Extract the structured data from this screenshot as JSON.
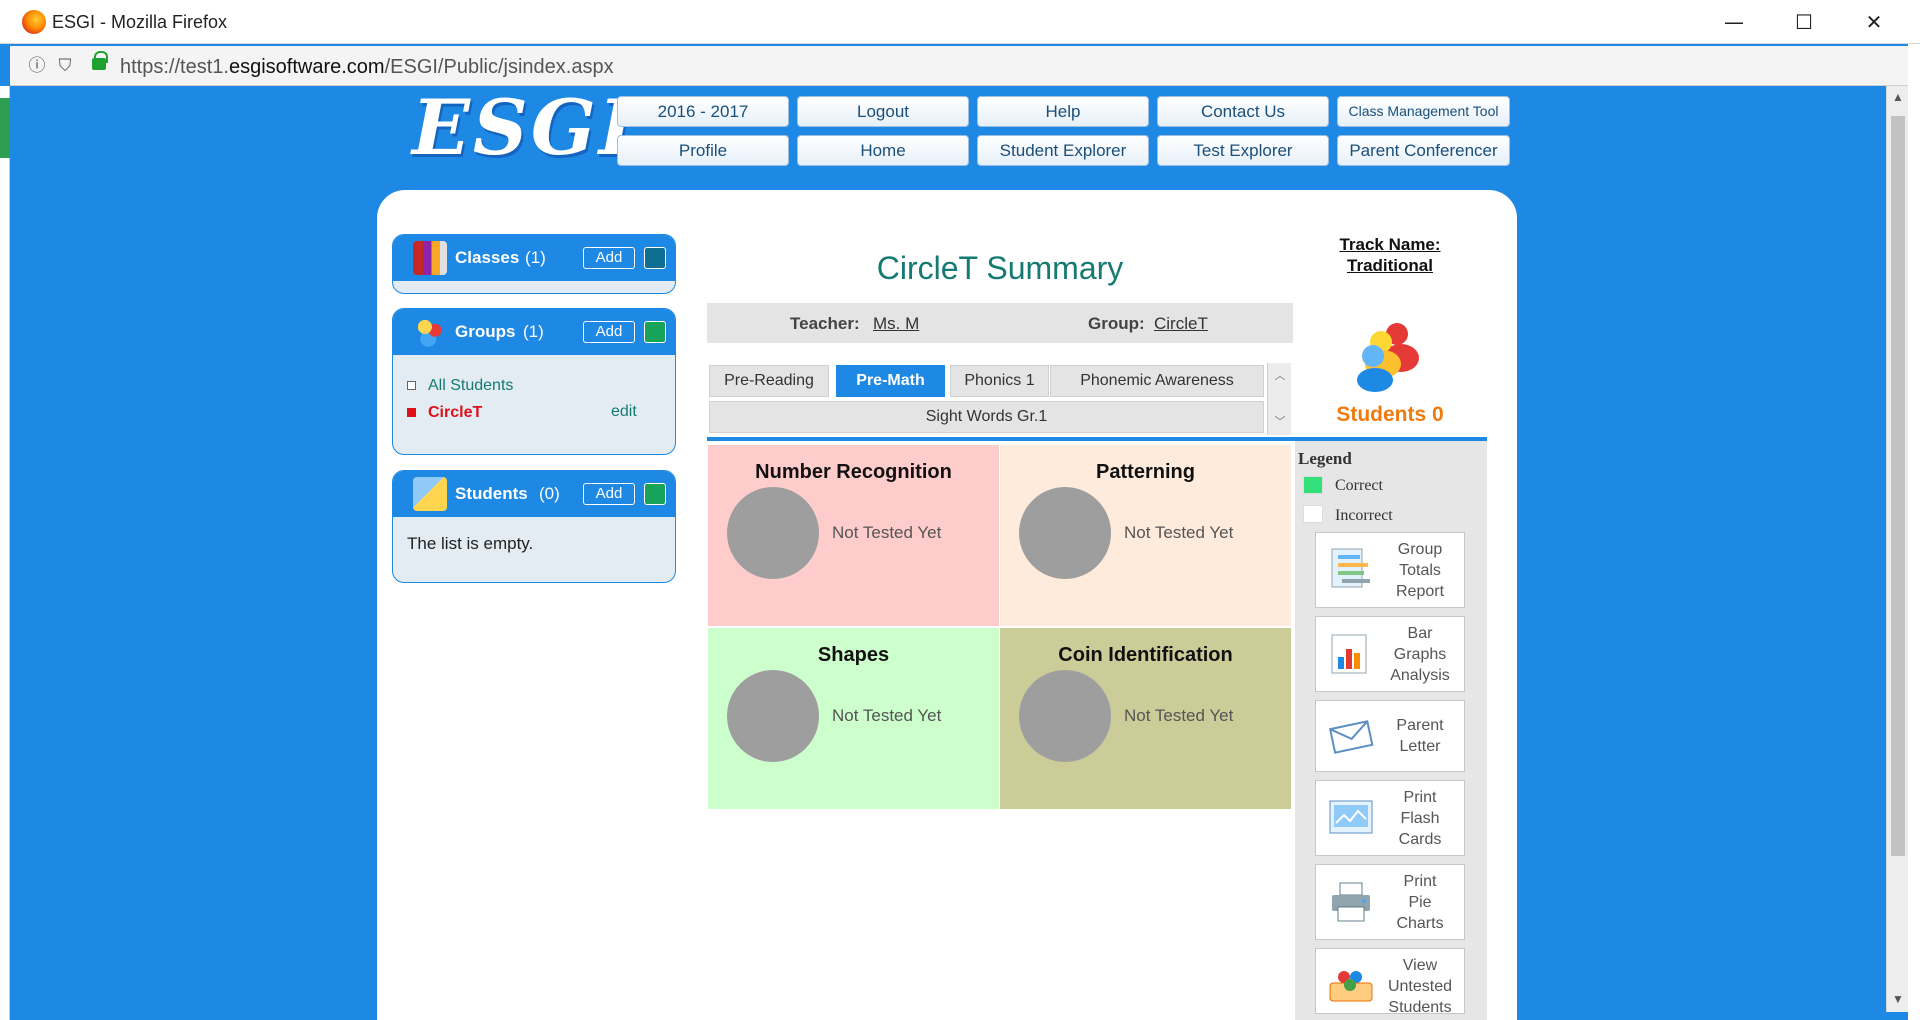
{
  "window": {
    "title": "ESGI - Mozilla Firefox",
    "url_prefix": "https://test1.",
    "url_domain": "esgisoftware.com",
    "url_path": "/ESGI/Public/jsindex.aspx",
    "minimize_glyph": "—",
    "maximize_glyph": "☐",
    "close_glyph": "✕"
  },
  "logo_text": "ESGI",
  "nav": {
    "row1": [
      "2016 - 2017",
      "Logout",
      "Help",
      "Contact Us",
      "Class Management Tool"
    ],
    "row2": [
      "Profile",
      "Home",
      "Student Explorer",
      "Test Explorer",
      "Parent Conferencer"
    ]
  },
  "sidebar": {
    "classes": {
      "label": "Classes",
      "count": "(1)",
      "add": "Add"
    },
    "groups": {
      "label": "Groups",
      "count": "(1)",
      "add": "Add",
      "items": [
        {
          "name": "All Students",
          "color": "#157a72"
        },
        {
          "name": "CircleT",
          "color": "#e0101a",
          "edit": "edit"
        }
      ]
    },
    "students": {
      "label": "Students",
      "count": "(0)",
      "add": "Add",
      "empty": "The list is empty."
    }
  },
  "main": {
    "title": "CircleT Summary",
    "teacher_label": "Teacher:",
    "teacher": "Ms. M",
    "group_label": "Group:",
    "group": "CircleT",
    "tabs": [
      "Pre-Reading",
      "Pre-Math",
      "Phonics 1",
      "Phonemic Awareness",
      "Sight Words Gr.1"
    ],
    "active_tab": "Pre-Math",
    "cells": [
      {
        "title": "Number Recognition",
        "status": "Not Tested Yet",
        "bg": "#ffcccc"
      },
      {
        "title": "Patterning",
        "status": "Not Tested Yet",
        "bg": "#ffebdc"
      },
      {
        "title": "Shapes",
        "status": "Not Tested Yet",
        "bg": "#ccffcc"
      },
      {
        "title": "Coin Identification",
        "status": "Not Tested Yet",
        "bg": "#cccc99"
      }
    ]
  },
  "right": {
    "track_line1": "Track Name:",
    "track_line2": "Traditional",
    "students_label": "Students 0",
    "legend_title": "Legend",
    "legend": [
      {
        "label": "Correct",
        "color": "#33e07a"
      },
      {
        "label": "Incorrect",
        "color": "#ffffff"
      }
    ],
    "reports": [
      {
        "lines": [
          "Group",
          "Totals",
          "Report"
        ],
        "icon": "report-icon"
      },
      {
        "lines": [
          "Bar",
          "Graphs",
          "Analysis"
        ],
        "icon": "bar-graph-icon"
      },
      {
        "lines": [
          "Parent",
          "Letter"
        ],
        "icon": "envelope-icon"
      },
      {
        "lines": [
          "Print",
          "Flash",
          "Cards"
        ],
        "icon": "flash-cards-icon"
      },
      {
        "lines": [
          "Print",
          "Pie",
          "Charts"
        ],
        "icon": "printer-icon"
      },
      {
        "lines": [
          "View",
          "Untested",
          "Students"
        ],
        "icon": "untested-students-icon"
      }
    ]
  },
  "colors": {
    "brand_blue": "#1e88e5",
    "teal": "#157a72",
    "orange": "#ef7b10"
  }
}
